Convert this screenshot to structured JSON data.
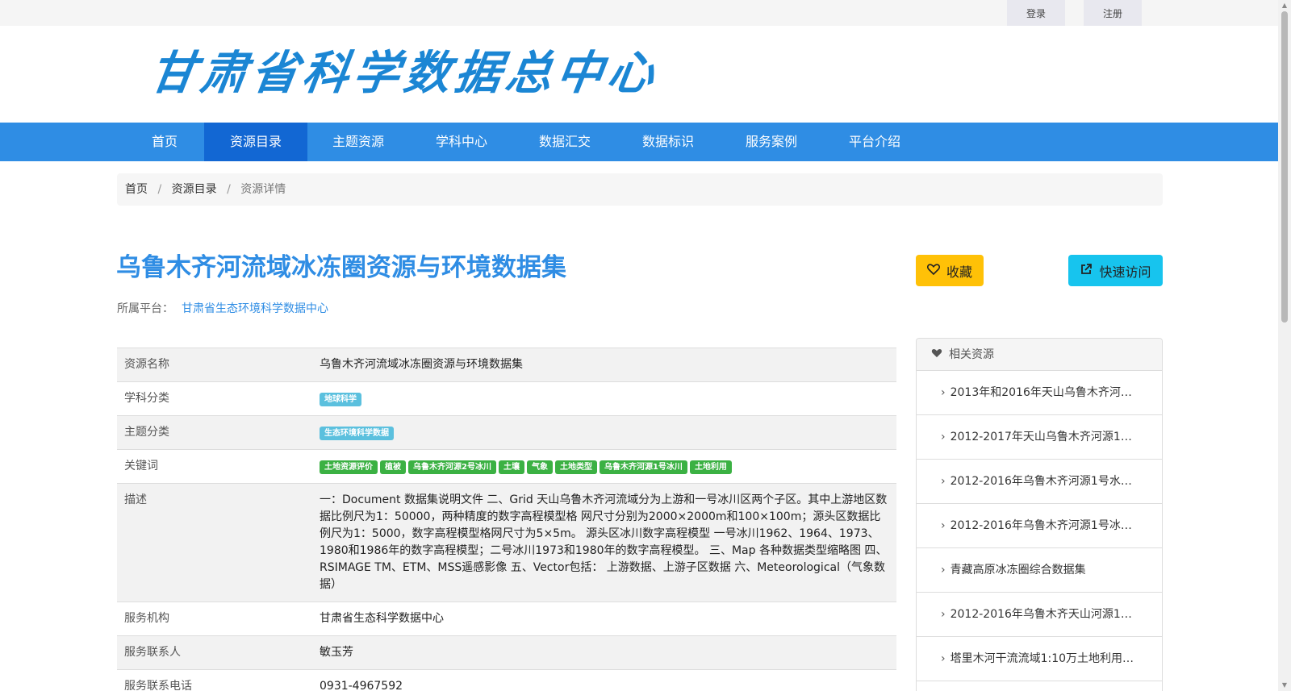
{
  "topbar": {
    "login_label": "登录",
    "register_label": "注册"
  },
  "logo": {
    "text": "甘肃省科学数据总中心"
  },
  "nav": {
    "items": [
      {
        "label": "首页"
      },
      {
        "label": "资源目录"
      },
      {
        "label": "主题资源"
      },
      {
        "label": "学科中心"
      },
      {
        "label": "数据汇交"
      },
      {
        "label": "数据标识"
      },
      {
        "label": "服务案例"
      },
      {
        "label": "平台介绍"
      }
    ],
    "active": "资源目录"
  },
  "breadcrumb": {
    "home": "首页",
    "catalog": "资源目录",
    "current": "资源详情",
    "separator": "/"
  },
  "resource": {
    "title": "乌鲁木齐河流域冰冻圈资源与环境数据集",
    "platform_label": "所属平台：",
    "platform_value": "甘肃省生态环境科学数据中心"
  },
  "actions": {
    "favorite_label": "收藏",
    "visit_label": "快速访问"
  },
  "info": {
    "rows": [
      {
        "label": "资源名称",
        "value": "乌鲁木齐河流域冰冻圈资源与环境数据集"
      },
      {
        "label": "学科分类",
        "tags": [
          "地球科学"
        ]
      },
      {
        "label": "主题分类",
        "tags": [
          "生态环境科学数据"
        ]
      },
      {
        "label": "关键词",
        "tags": [
          "土地资源评价",
          "植被",
          "乌鲁木齐河源2号冰川",
          "土壤",
          "气象",
          "土地类型",
          "乌鲁木齐河源1号冰川",
          "土地利用"
        ]
      },
      {
        "label": "描述",
        "value": "一：Document 数据集说明文件 二、Grid 天山乌鲁木齐河流域分为上游和一号冰川区两个子区。其中上游地区数据比例尺为1：50000，两种精度的数字高程模型格 网尺寸分别为2000×2000m和100×100m；源头区数据比例尺为1：5000，数字高程模型格网尺寸为5×5m。 源头区冰川数字高程模型 一号冰川1962、1964、1973、1980和1986年的数字高程模型；二号冰川1973和1980年的数字高程模型。 三、Map 各种数据类型缩略图 四、RSIMAGE TM、ETM、MSS遥感影像 五、Vector包括： 上游数据、上游子区数据 六、Meteorological（气象数据）"
      },
      {
        "label": "服务机构",
        "value": "甘肃省生态科学数据中心"
      },
      {
        "label": "服务联系人",
        "value": "敏玉芳"
      },
      {
        "label": "服务联系电话",
        "value": "0931-4967592"
      }
    ]
  },
  "related": {
    "header": "相关资源",
    "items": [
      "2013年和2016年天山乌鲁木齐河…",
      "2012-2017年天山乌鲁木齐河源1…",
      "2012-2016年乌鲁木齐河源1号水…",
      "2012-2016年乌鲁木齐河源1号冰…",
      "青藏高原冰冻圈综合数据集",
      "2012-2016年乌鲁木齐天山河源1…",
      "塔里木河干流流域1:10万土地利用…"
    ]
  },
  "colors": {
    "accent": "#2f8de4",
    "nav_active": "#1267d3",
    "favorite": "#ffc107",
    "visit": "#17c4ee",
    "tag_blue": "#5bc0de",
    "tag_green": "#3bb143"
  },
  "icons": {
    "favorite": "heart-outline-icon",
    "visit": "external-link-icon",
    "related": "heart-icon",
    "related_item": "chevron-right-icon"
  }
}
